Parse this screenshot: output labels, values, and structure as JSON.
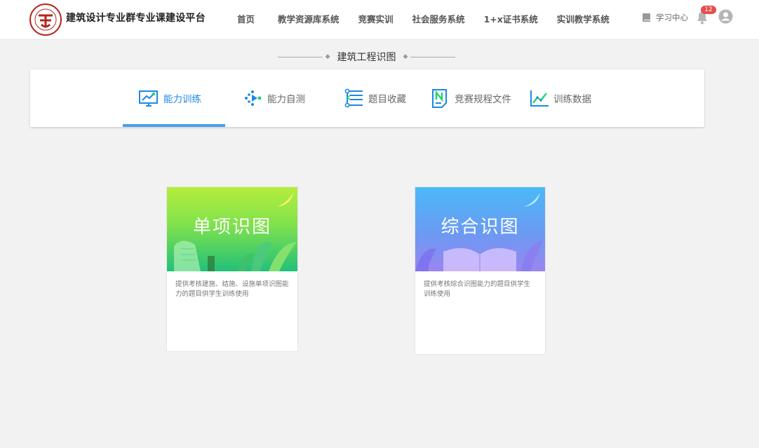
{
  "header": {
    "brand": "建筑设计专业群专业课建设平台",
    "nav": [
      "首页",
      "教学资源库系统",
      "竞赛实训",
      "社会服务系统",
      "1+x证书系统",
      "实训教学系统"
    ],
    "study_center": "学习中心",
    "notification_count": "12"
  },
  "section": {
    "title": "建筑工程识图"
  },
  "tabs": [
    {
      "label": "能力训练",
      "icon": "monitor-chart-icon",
      "active": true
    },
    {
      "label": "能力自测",
      "icon": "self-test-icon",
      "active": false
    },
    {
      "label": "题目收藏",
      "icon": "list-collect-icon",
      "active": false
    },
    {
      "label": "竞赛规程文件",
      "icon": "document-n-icon",
      "active": false
    },
    {
      "label": "训练数据",
      "icon": "line-chart-icon",
      "active": false
    }
  ],
  "cards": [
    {
      "title": "单项识图",
      "description": "提供考核建施、结施、设施单项识图能力的题目供学生训练使用"
    },
    {
      "title": "综合识图",
      "description": "提供考核综合识图能力的题目供学生训练使用"
    }
  ],
  "colors": {
    "accent": "#1e88e5",
    "badge": "#e84c4c",
    "logo_red": "#b3261e"
  }
}
